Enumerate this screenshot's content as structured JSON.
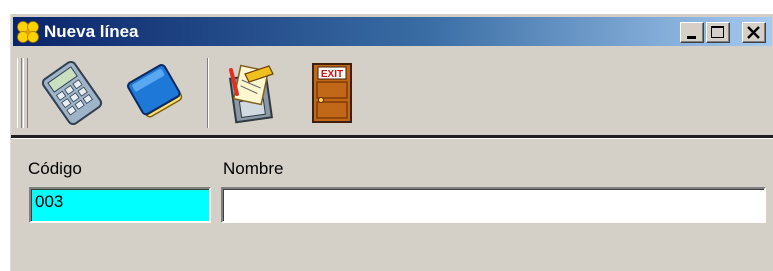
{
  "window": {
    "title": "Nueva línea",
    "title_icon": "clover-icon",
    "controls": [
      "minimize-icon",
      "maximize-icon",
      "close-icon"
    ]
  },
  "toolbar": {
    "buttons": [
      {
        "icon": "calculator-icon"
      },
      {
        "icon": "book-icon"
      },
      {
        "icon": "save-document-icon"
      },
      {
        "icon": "exit-door-icon",
        "text": "EXIT"
      }
    ]
  },
  "form": {
    "codigo_label": "Código",
    "codigo_value": "003",
    "nombre_label": "Nombre",
    "nombre_value": ""
  },
  "colors": {
    "titlebar_start": "#0a246a",
    "titlebar_end": "#a6caf0",
    "window_bg": "#d4d0c8",
    "codigo_field_bg": "#00ffff"
  }
}
